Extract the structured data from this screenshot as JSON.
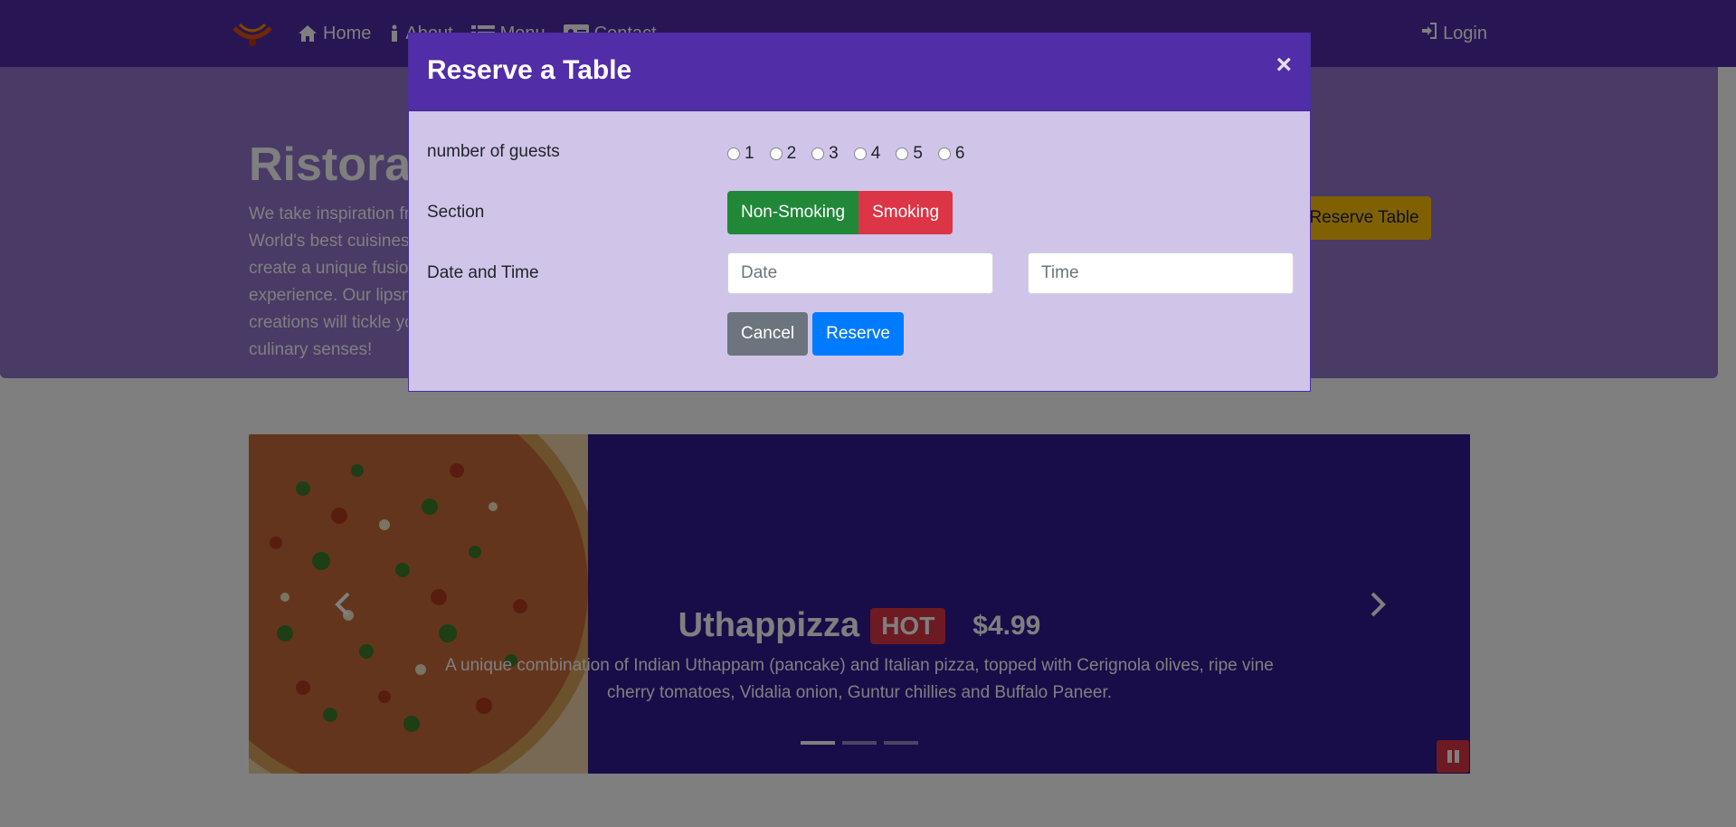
{
  "nav": {
    "home": "Home",
    "about": "About",
    "menu": "Menu",
    "contact": "Contact",
    "login": "Login"
  },
  "jumbotron": {
    "title": "Ristorante con Fusion",
    "text": "We take inspiration from the World's best cuisines, and create a unique fusion experience. Our lipsmacking creations will tickle your culinary senses!",
    "reserve_button": "Reserve Table"
  },
  "carousel": {
    "title": "Uthappizza",
    "badge": "HOT",
    "price": "$4.99",
    "description": "A unique combination of Indian Uthappam (pancake) and Italian pizza, topped with Cerignola olives, ripe vine cherry tomatoes, Vidalia onion, Guntur chillies and Buffalo Paneer.",
    "indicators": 3,
    "active_indicator": 1
  },
  "modal": {
    "title": "Reserve a Table",
    "close": "×",
    "guests_label": "number of guests",
    "guest_options": [
      "1",
      "2",
      "3",
      "4",
      "5",
      "6"
    ],
    "section_label": "Section",
    "section_options": [
      "Non-Smoking",
      "Smoking"
    ],
    "datetime_label": "Date and Time",
    "date_placeholder": "Date",
    "time_placeholder": "Time",
    "cancel": "Cancel",
    "reserve": "Reserve"
  },
  "colors": {
    "primary": "#512da8",
    "primary_light": "#d1c4e9",
    "jumbotron": "#9575cd",
    "carousel": "#311b92",
    "success": "#218838",
    "danger": "#dc3545",
    "warning": "#ffc107",
    "blue": "#007bff",
    "gray": "#6c757d"
  }
}
